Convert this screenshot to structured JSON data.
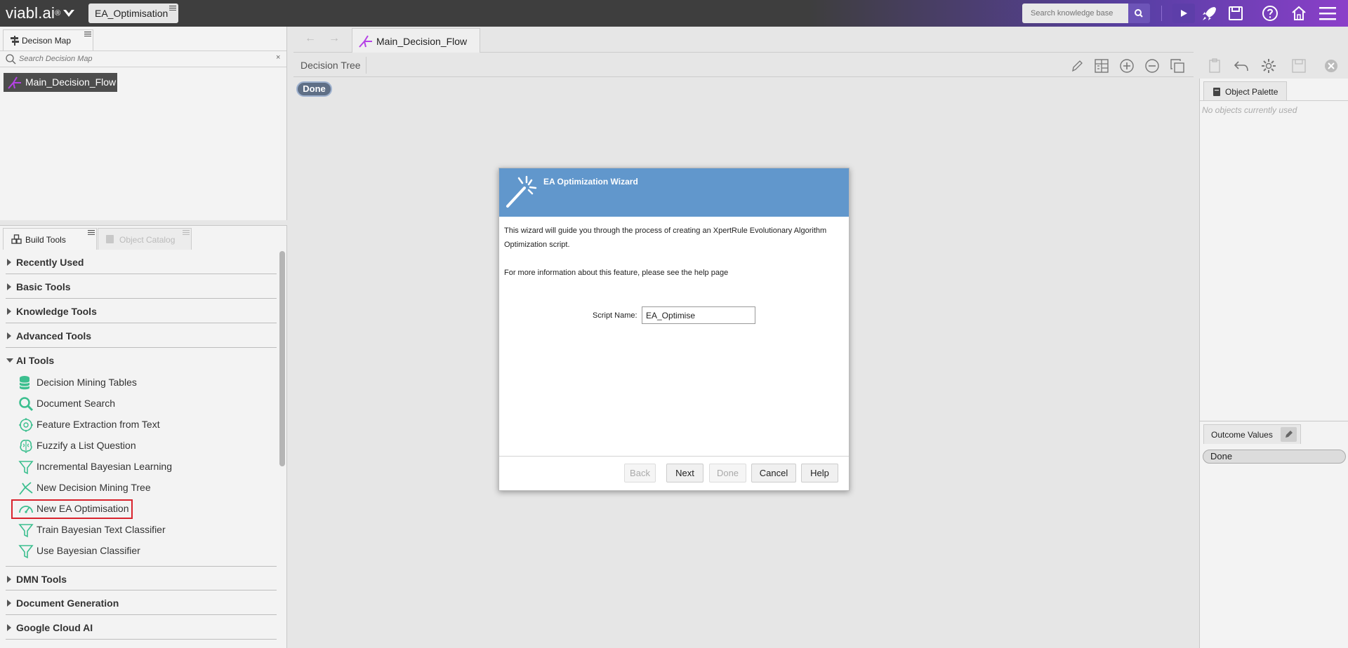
{
  "topbar": {
    "logo_text": "viabl.ai",
    "logo_sup": "®",
    "kb_tab": "EA_Optimisation",
    "search_placeholder": "Search knowledge base",
    "accent_color": "#6d54b8"
  },
  "decision_map": {
    "tab_label": "Decison Map",
    "search_placeholder": "Search Decision Map",
    "items": [
      "Main_Decision_Flow"
    ]
  },
  "build_tools": {
    "tab_label": "Build Tools",
    "catalog_tab_label": "Object Catalog",
    "categories": [
      {
        "label": "Recently Used"
      },
      {
        "label": "Basic Tools"
      },
      {
        "label": "Knowledge Tools"
      },
      {
        "label": "Advanced Tools"
      },
      {
        "label": "AI Tools"
      },
      {
        "label": "DMN Tools"
      },
      {
        "label": "Document Generation"
      },
      {
        "label": "Google Cloud AI"
      }
    ],
    "ai_tools": [
      {
        "label": "Decision Mining Tables",
        "icon": "database-icon"
      },
      {
        "label": "Document Search",
        "icon": "magnifier-icon"
      },
      {
        "label": "Feature Extraction from Text",
        "icon": "chip-icon"
      },
      {
        "label": "Fuzzify a List Question",
        "icon": "brain-icon"
      },
      {
        "label": "Incremental Bayesian Learning",
        "icon": "funnel-icon"
      },
      {
        "label": "New Decision Mining Tree",
        "icon": "tree-icon"
      },
      {
        "label": "New EA Optimisation",
        "icon": "gauge-icon"
      },
      {
        "label": "Train Bayesian Text Classifier",
        "icon": "funnel-icon"
      },
      {
        "label": "Use Bayesian Classifier",
        "icon": "funnel-icon"
      }
    ],
    "tool_icon_color": "#3cbf8f",
    "highlight_color": "#d9232d"
  },
  "editor": {
    "flow_tab": "Main_Decision_Flow",
    "view_label": "Decision Tree",
    "done_node": "Done"
  },
  "wizard": {
    "title": "EA Optimization Wizard",
    "intro": "This wizard will guide you through the process of creating an XpertRule Evolutionary Algorithm Optimization script.",
    "help_text": "For more information about this feature, please see the help page",
    "script_label": "Script Name:",
    "script_value": "EA_Optimise",
    "buttons": {
      "back": "Back",
      "next": "Next",
      "done": "Done",
      "cancel": "Cancel",
      "help": "Help"
    },
    "header_color": "#6197cc"
  },
  "object_palette": {
    "tab_label": "Object Palette",
    "empty_text": "No objects currently used"
  },
  "outcome_values": {
    "tab_label": "Outcome Values",
    "values": [
      "Done"
    ]
  }
}
